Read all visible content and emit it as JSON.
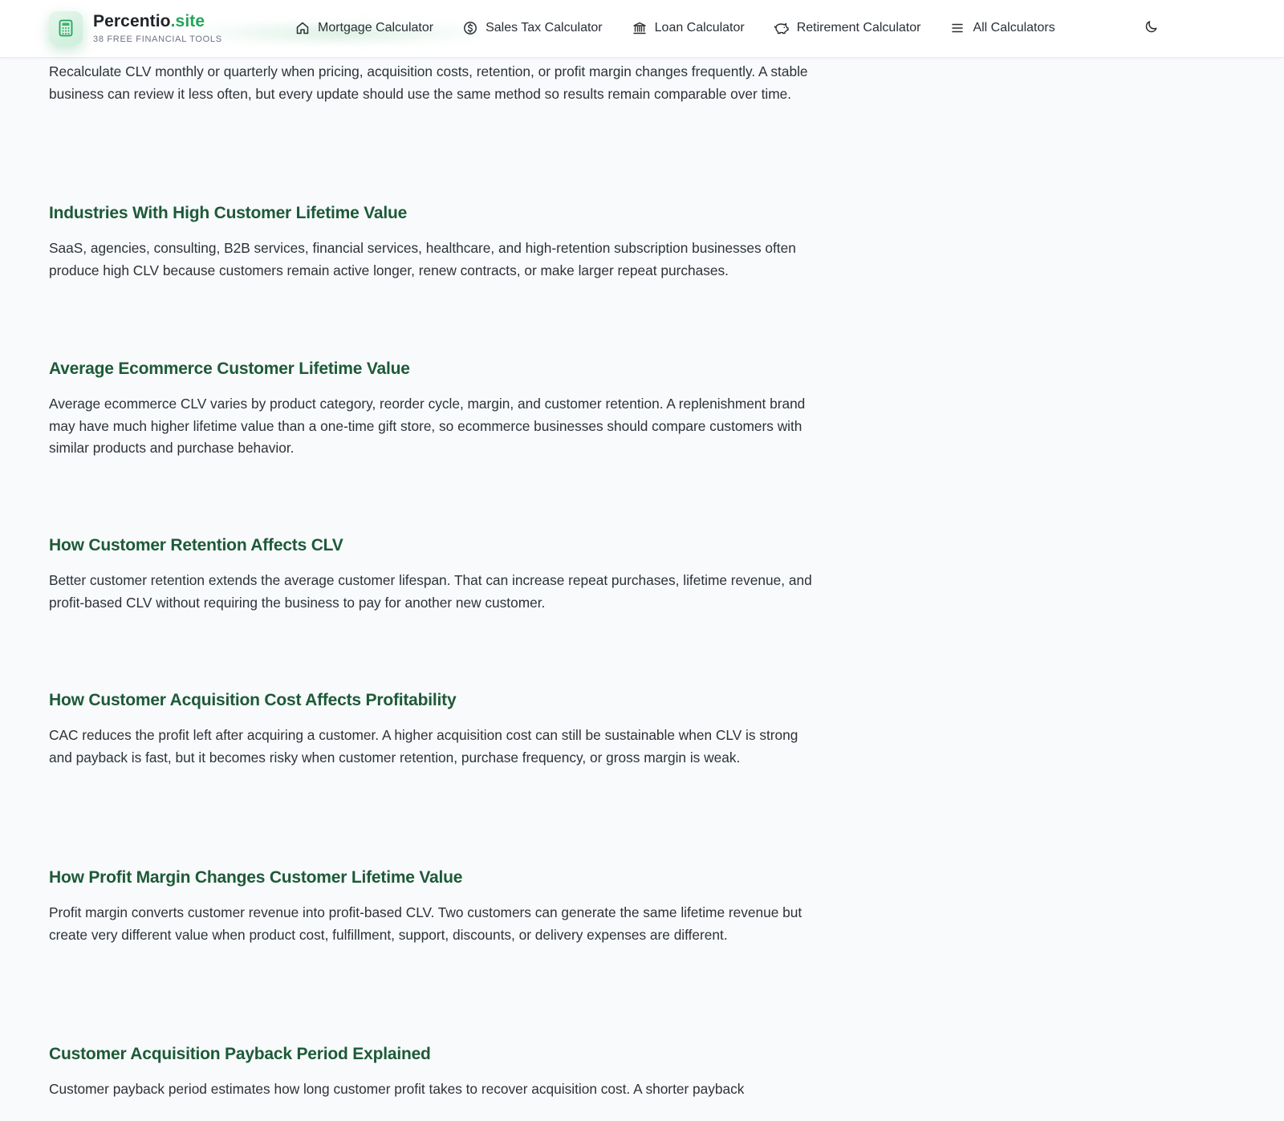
{
  "header": {
    "brand_name": "Percentio",
    "brand_suffix": ".site",
    "brand_tagline": "38 FREE FINANCIAL TOOLS",
    "brand_icon": "calculator-icon",
    "nav": [
      {
        "label": "Mortgage Calculator",
        "icon": "home-icon"
      },
      {
        "label": "Sales Tax Calculator",
        "icon": "dollar-circle-icon"
      },
      {
        "label": "Loan Calculator",
        "icon": "bank-icon"
      },
      {
        "label": "Retirement Calculator",
        "icon": "piggy-bank-icon"
      },
      {
        "label": "All Calculators",
        "icon": "menu-icon"
      }
    ],
    "theme_toggle_icon": "moon-icon"
  },
  "content": {
    "lead_paragraph": "Recalculate CLV monthly or quarterly when pricing, acquisition costs, retention, or profit margin changes frequently. A stable business can review it less often, but every update should use the same method so results remain comparable over time.",
    "sections": [
      {
        "heading": "Industries With High Customer Lifetime Value",
        "body": "SaaS, agencies, consulting, B2B services, financial services, healthcare, and high-retention subscription businesses often produce high CLV because customers remain active longer, renew contracts, or make larger repeat purchases."
      },
      {
        "heading": "Average Ecommerce Customer Lifetime Value",
        "body": "Average ecommerce CLV varies by product category, reorder cycle, margin, and customer retention. A replenishment brand may have much higher lifetime value than a one-time gift store, so ecommerce businesses should compare customers with similar products and purchase behavior."
      },
      {
        "heading": "How Customer Retention Affects CLV",
        "body": "Better customer retention extends the average customer lifespan. That can increase repeat purchases, lifetime revenue, and profit-based CLV without requiring the business to pay for another new customer."
      },
      {
        "heading": "How Customer Acquisition Cost Affects Profitability",
        "body": "CAC reduces the profit left after acquiring a customer. A higher acquisition cost can still be sustainable when CLV is strong and payback is fast, but it becomes risky when customer retention, purchase frequency, or gross margin is weak."
      },
      {
        "heading": "How Profit Margin Changes Customer Lifetime Value",
        "body": "Profit margin converts customer revenue into profit-based CLV. Two customers can generate the same lifetime revenue but create very different value when product cost, fulfillment, support, discounts, or delivery expenses are different."
      },
      {
        "heading": "Customer Acquisition Payback Period Explained",
        "body": "Customer payback period estimates how long customer profit takes to recover acquisition cost. A shorter payback"
      }
    ]
  },
  "colors": {
    "accent": "#22a559",
    "heading": "#1d5a37",
    "background": "#f8fafc"
  }
}
